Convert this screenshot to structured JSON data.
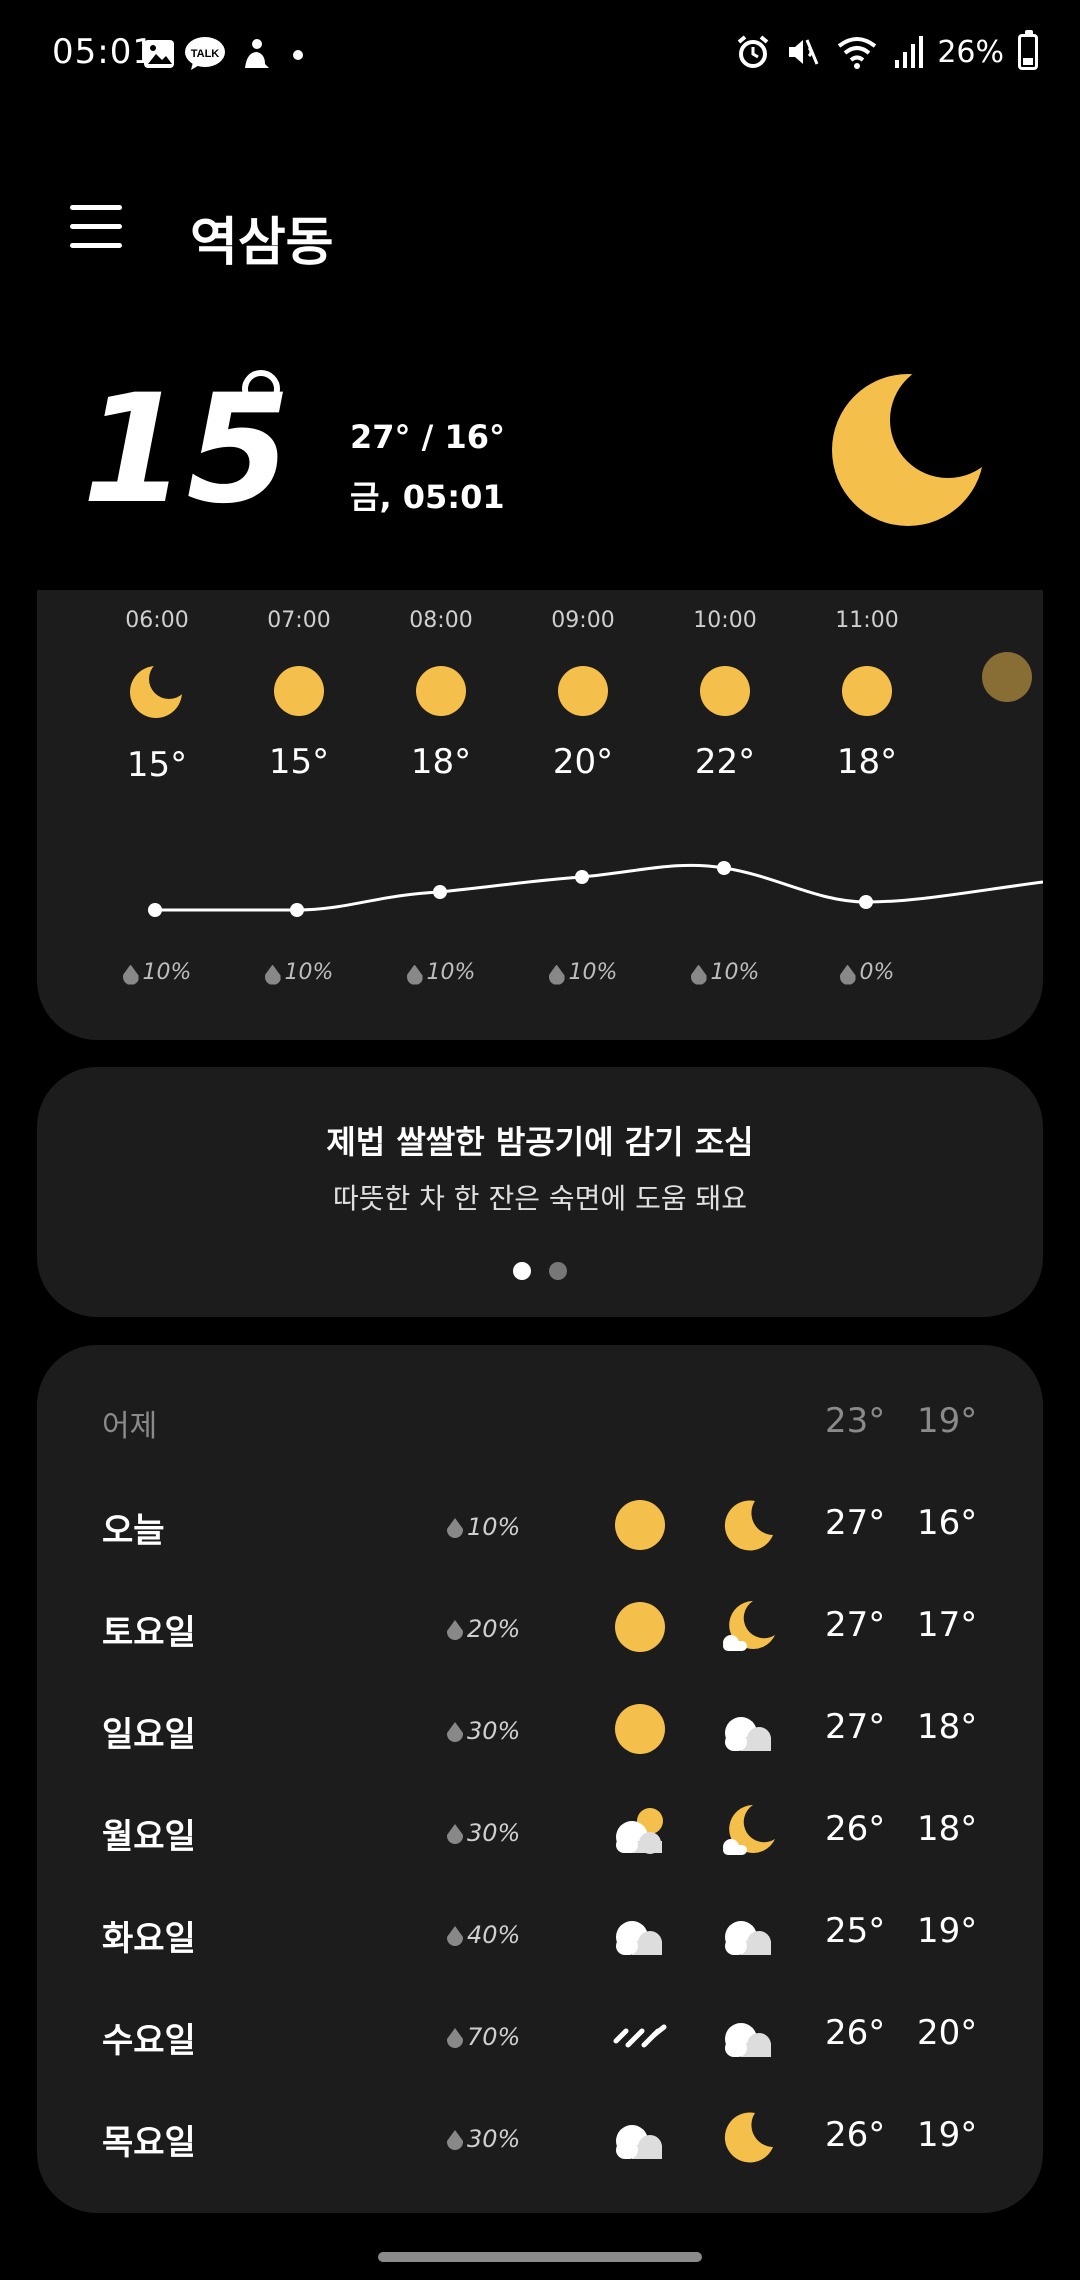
{
  "status": {
    "time": "05:01",
    "battery": "26%"
  },
  "header": {
    "location": "역삼동"
  },
  "current": {
    "temp": "15",
    "hilo": "27° / 16°",
    "datetime": "금, 05:01"
  },
  "hourly": [
    {
      "time": "06:00",
      "icon": "moon-icon",
      "temp": "15°",
      "precip": "10%"
    },
    {
      "time": "07:00",
      "icon": "sun-icon",
      "temp": "15°",
      "precip": "10%"
    },
    {
      "time": "08:00",
      "icon": "sun-icon",
      "temp": "18°",
      "precip": "10%"
    },
    {
      "time": "09:00",
      "icon": "sun-icon",
      "temp": "20°",
      "precip": "10%"
    },
    {
      "time": "10:00",
      "icon": "sun-icon",
      "temp": "22°",
      "precip": "10%"
    },
    {
      "time": "11:00",
      "icon": "sun-icon",
      "temp": "18°",
      "precip": "0%"
    }
  ],
  "tip": {
    "title": "제법 쌀쌀한 밤공기에 감기 조심",
    "subtitle": "따뜻한 차 한 잔은 숙면에 도움 돼요"
  },
  "daily": {
    "yesterday": {
      "label": "어제",
      "high": "23°",
      "low": "19°"
    },
    "days": [
      {
        "name": "오늘",
        "precip": "10%",
        "am": "sun-icon",
        "pm": "moon-icon",
        "high": "27°",
        "low": "16°"
      },
      {
        "name": "토요일",
        "precip": "20%",
        "am": "sun-icon",
        "pm": "moon-cloud-icon",
        "high": "27°",
        "low": "17°"
      },
      {
        "name": "일요일",
        "precip": "30%",
        "am": "sun-icon",
        "pm": "cloud-icon",
        "high": "27°",
        "low": "18°"
      },
      {
        "name": "월요일",
        "precip": "30%",
        "am": "sun-cloud-icon",
        "pm": "moon-cloud-icon",
        "high": "26°",
        "low": "18°"
      },
      {
        "name": "화요일",
        "precip": "40%",
        "am": "cloud-icon",
        "pm": "cloud-icon",
        "high": "25°",
        "low": "19°"
      },
      {
        "name": "수요일",
        "precip": "70%",
        "am": "rain-icon",
        "pm": "cloud-icon",
        "high": "26°",
        "low": "20°"
      },
      {
        "name": "목요일",
        "precip": "30%",
        "am": "cloud-icon",
        "pm": "moon-icon",
        "high": "26°",
        "low": "19°"
      }
    ]
  },
  "colors": {
    "accent": "#f4c04b",
    "card": "#1c1c1c"
  }
}
